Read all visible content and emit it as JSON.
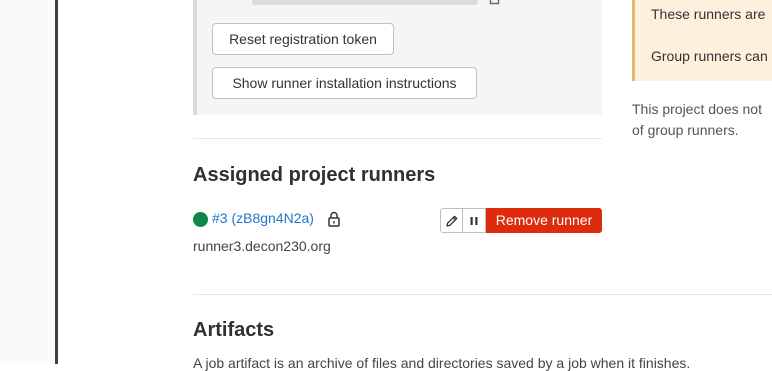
{
  "token_section": {
    "reset_button": "Reset registration token",
    "install_button": "Show runner installation instructions"
  },
  "group_runners": {
    "alert_line_1": "These runners are",
    "alert_line_2": "Group runners can",
    "note_line_1": "This project does not",
    "note_line_2": "of group runners."
  },
  "assigned_runners": {
    "heading": "Assigned project runners",
    "runner": {
      "link": "#3 (zB8gn4N2a)",
      "description": "runner3.decon230.org",
      "status": "online",
      "remove_label": "Remove runner"
    }
  },
  "artifacts": {
    "heading": "Artifacts",
    "description": "A job artifact is an archive of files and directories saved by a job when it finishes."
  },
  "colors": {
    "status_online": "#108548",
    "danger": "#dd2b0e",
    "link": "#1f75cb",
    "warning_bg": "#fdf1dd"
  }
}
